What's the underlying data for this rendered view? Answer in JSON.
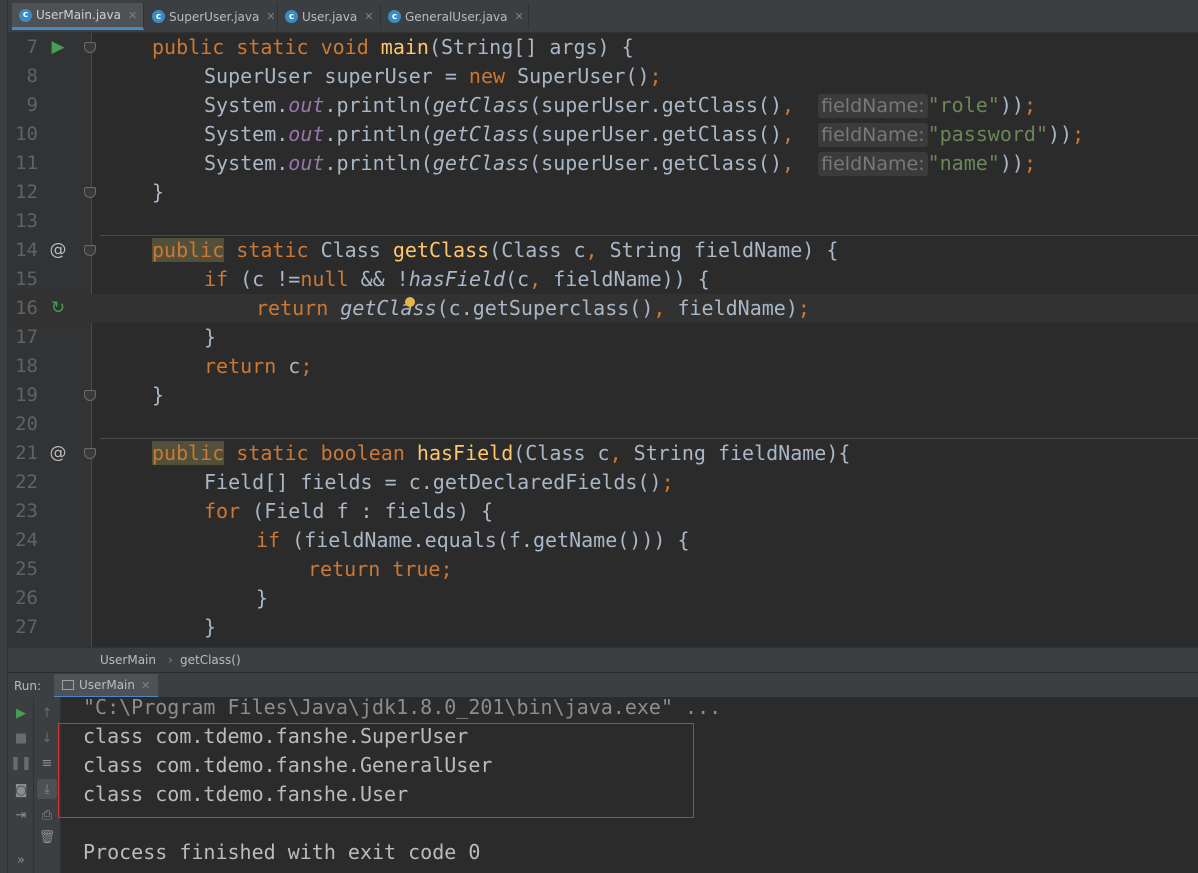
{
  "tabs": [
    {
      "label": "UserMain.java",
      "active": true
    },
    {
      "label": "SuperUser.java",
      "active": false
    },
    {
      "label": "User.java",
      "active": false
    },
    {
      "label": "GeneralUser.java",
      "active": false
    }
  ],
  "editor": {
    "line_numbers": [
      "7",
      "8",
      "9",
      "10",
      "11",
      "12",
      "13",
      "14",
      "15",
      "16",
      "17",
      "18",
      "19",
      "20",
      "21",
      "22",
      "23",
      "24",
      "25",
      "26",
      "27"
    ],
    "current_line": "16",
    "param_hint": "fieldName:",
    "strings": {
      "role": "\"role\"",
      "password": "\"password\"",
      "name": "\"name\""
    }
  },
  "breadcrumb": {
    "file": "UserMain",
    "method": "getClass()"
  },
  "run": {
    "label": "Run:",
    "tab_label": "UserMain",
    "output": [
      "\"C:\\Program Files\\Java\\jdk1.8.0_201\\bin\\java.exe\" ...",
      "class com.tdemo.fanshe.SuperUser",
      "class com.tdemo.fanshe.GeneralUser",
      "class com.tdemo.fanshe.User",
      "",
      "Process finished with exit code 0"
    ]
  },
  "colors": {
    "accent": "#4a88c7",
    "keyword": "#cc7832",
    "method": "#ffc66d",
    "string": "#6a8759",
    "highlight_box": "#d13434"
  }
}
